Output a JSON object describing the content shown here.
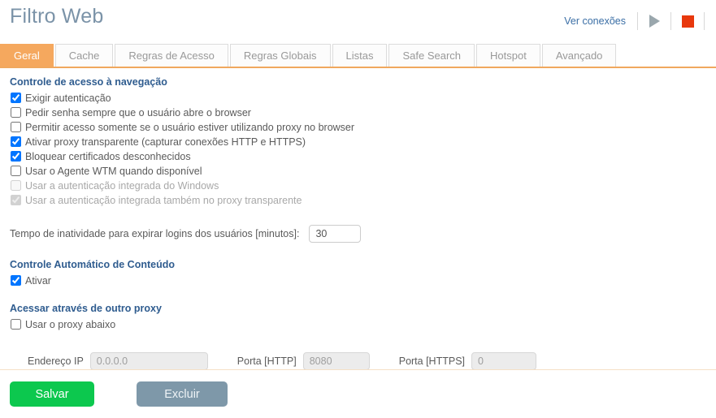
{
  "header": {
    "title": "Filtro Web",
    "connections_link": "Ver conexões",
    "play_icon": "play-icon",
    "stop_icon": "stop-icon"
  },
  "tabs": [
    {
      "label": "Geral",
      "active": true
    },
    {
      "label": "Cache",
      "active": false
    },
    {
      "label": "Regras de Acesso",
      "active": false
    },
    {
      "label": "Regras Globais",
      "active": false
    },
    {
      "label": "Listas",
      "active": false
    },
    {
      "label": "Safe Search",
      "active": false
    },
    {
      "label": "Hotspot",
      "active": false
    },
    {
      "label": "Avançado",
      "active": false
    }
  ],
  "sections": {
    "access_control": {
      "title": "Controle de acesso à navegação",
      "options": [
        {
          "label": "Exigir autenticação",
          "checked": true,
          "disabled": false
        },
        {
          "label": "Pedir senha sempre que o usuário abre o browser",
          "checked": false,
          "disabled": false
        },
        {
          "label": "Permitir acesso somente se o usuário estiver utilizando proxy no browser",
          "checked": false,
          "disabled": false
        },
        {
          "label": "Ativar proxy transparente (capturar conexões HTTP e HTTPS)",
          "checked": true,
          "disabled": false
        },
        {
          "label": "Bloquear certificados desconhecidos",
          "checked": true,
          "disabled": false
        },
        {
          "label": "Usar o Agente WTM quando disponível",
          "checked": false,
          "disabled": false
        },
        {
          "label": "Usar a autenticação integrada do Windows",
          "checked": false,
          "disabled": true
        },
        {
          "label": "Usar a autenticação integrada também no proxy transparente",
          "checked": true,
          "disabled": true
        }
      ]
    },
    "timeout": {
      "label": "Tempo de inatividade para expirar logins dos usuários [minutos]:",
      "value": "30"
    },
    "auto_content": {
      "title": "Controle Automático de Conteúdo",
      "options": [
        {
          "label": "Ativar",
          "checked": true,
          "disabled": false
        }
      ]
    },
    "other_proxy": {
      "title": "Acessar através de outro proxy",
      "options": [
        {
          "label": "Usar o proxy abaixo",
          "checked": false,
          "disabled": false
        }
      ],
      "ip_label": "Endereço IP",
      "ip_value": "0.0.0.0",
      "http_label": "Porta [HTTP]",
      "http_value": "8080",
      "https_label": "Porta [HTTPS]",
      "https_value": "0"
    }
  },
  "footer": {
    "save_label": "Salvar",
    "delete_label": "Excluir"
  },
  "colors": {
    "accent_orange": "#f5a85e",
    "section_blue": "#2f5c8f",
    "link_blue": "#3a6ea5",
    "save_green": "#0cc84e",
    "delete_gray": "#7e98a9",
    "stop_red": "#e8380d"
  }
}
